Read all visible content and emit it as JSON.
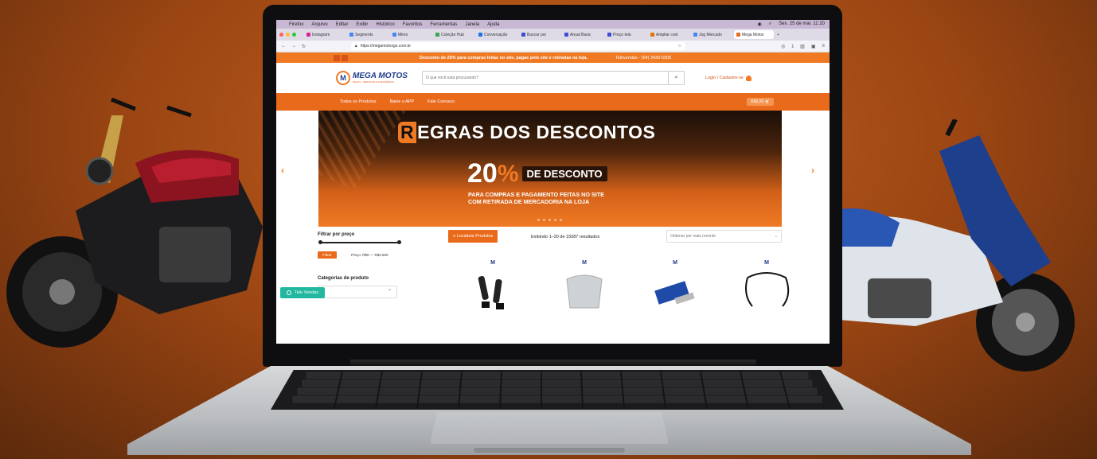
{
  "menubar": {
    "items": [
      "Firefox",
      "Arquivo",
      "Editar",
      "Exibir",
      "Histórico",
      "Favoritos",
      "Ferramentas",
      "Janela",
      "Ajuda"
    ],
    "clock": "Sex. 25 de mai. 11:20"
  },
  "browser": {
    "tabs": [
      "Instagram",
      "Segments",
      "Mimo",
      "Coleção Hub",
      "Conversação",
      "Buscar por",
      "Anual Basic",
      "Preço tela",
      "Ampliar cool",
      "Jog Mercado",
      "Mega Motos"
    ],
    "url": "https://megamotosgo.com.br"
  },
  "site": {
    "promo": "Desconto de 20% para compras feitas no site, pagas pelo site e retiradas na loja.",
    "phone": "Televendas - (64) 3430-5905",
    "logo_title": "MEGA MOTOS",
    "logo_sub": "PEÇAS · SERVIÇOS E ACESSÓRIOS",
    "search_placeholder": "O que você está procurando?",
    "login": "Login / Cadastre-se",
    "nav": [
      "Todos os Produtos",
      "Baixe o APP",
      "Fale Conosco"
    ],
    "cart": "R$0,00"
  },
  "hero": {
    "title_initial": "R",
    "title_rest": "EGRAS DOS DESCONTOS",
    "percent": "20",
    "percent_sign": "%",
    "tag": "DE DESCONTO",
    "sub_line1": "PARA COMPRAS E PAGAMENTO FEITAS NO SITE",
    "sub_line2": "COM RETIRADA DE MERCADORIA NA LOJA"
  },
  "shop": {
    "filter_title": "Filtrar por preço",
    "filter_button": "Filtrar",
    "price_range": "Preço: R$0 — R$2.500",
    "categories_title": "Categorias de produto",
    "chat_button": "Tele Vendas",
    "locate_button": "≡ Localizar Produtos",
    "results": "Exibindo 1–20 de 15087 resultados",
    "sort": "Ordenar por mais recente"
  },
  "colors": {
    "brand_orange": "#ea6a1c",
    "brand_blue": "#1f3c8a",
    "background": "#9a4513"
  }
}
